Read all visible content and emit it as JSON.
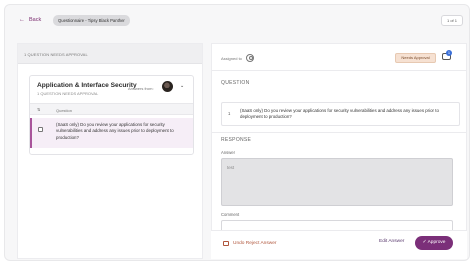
{
  "header": {
    "back_label": "Back",
    "questionnaire_chip": "Questionnaire - Tipsy Black Panther",
    "pager": "1 of 1"
  },
  "left_panel": {
    "header": "1 QUESTION NEEDS APPROVAL",
    "card": {
      "title": "Application & Interface Security",
      "subtitle": "1 QUESTION NEEDS APPROVAL",
      "answers_from": "Answers from:",
      "columns": [
        "",
        "Question"
      ],
      "rows": [
        {
          "text": "(SaaS only) Do you review your applications for security vulnerabilities and address any issues prior to deployment to production?"
        }
      ]
    }
  },
  "right_panel": {
    "assigned_label": "Assigned to",
    "badge": "Needs Approval",
    "comment_count": "1",
    "question_section": "QUESTION",
    "question_number": "1",
    "question_text": "(SaaS only) Do you review your applications for security vulnerabilities and address any issues prior to deployment to production?",
    "response_section": "RESPONSE",
    "answer_label": "Answer",
    "answer_value": "test",
    "comment_label": "Comment"
  },
  "footer": {
    "undo_label": "Undo Reject Answer",
    "edit_label": "Edit Answer",
    "approve_label": "Approve"
  },
  "colors": {
    "accent": "#7b2f79",
    "badge_bg": "#f6e1d2",
    "selected_row": "#f6eef7"
  }
}
